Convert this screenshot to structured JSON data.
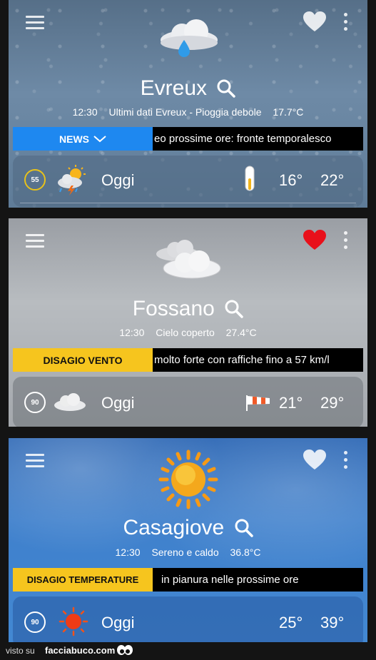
{
  "panels": [
    {
      "city": "Evreux",
      "time": "12:30",
      "status": "Ultimi dati Evreux - Pioggia debole",
      "temp": "17.7°C",
      "ticker_label": "NEWS",
      "ticker_text": "eo prossime ore: fronte temporalesco",
      "badge": "55",
      "day": "Oggi",
      "tmin": "16°",
      "tmax": "22°",
      "weather_icon": "rain-cloud-icon",
      "favorite": false
    },
    {
      "city": "Fossano",
      "time": "12:30",
      "status": "Cielo coperto",
      "temp": "27.4°C",
      "ticker_label": "DISAGIO VENTO",
      "ticker_text": "molto forte con raffiche fino a 57 km/l",
      "badge": "90",
      "day": "Oggi",
      "tmin": "21°",
      "tmax": "29°",
      "weather_icon": "overcast-clouds-icon",
      "favorite": true
    },
    {
      "city": "Casagiove",
      "time": "12:30",
      "status": "Sereno e caldo",
      "temp": "36.8°C",
      "ticker_label": "DISAGIO TEMPERATURE",
      "ticker_text": "in pianura nelle prossime ore",
      "badge": "90",
      "day": "Oggi",
      "tmin": "25°",
      "tmax": "39°",
      "weather_icon": "sun-icon",
      "favorite": false
    }
  ],
  "footer": {
    "left": "visto su",
    "brand": "facciabuco.com"
  },
  "colors": {
    "news_blue": "#1e88f0",
    "alert_yellow": "#f6c51e",
    "heart_red": "#e8101a"
  }
}
